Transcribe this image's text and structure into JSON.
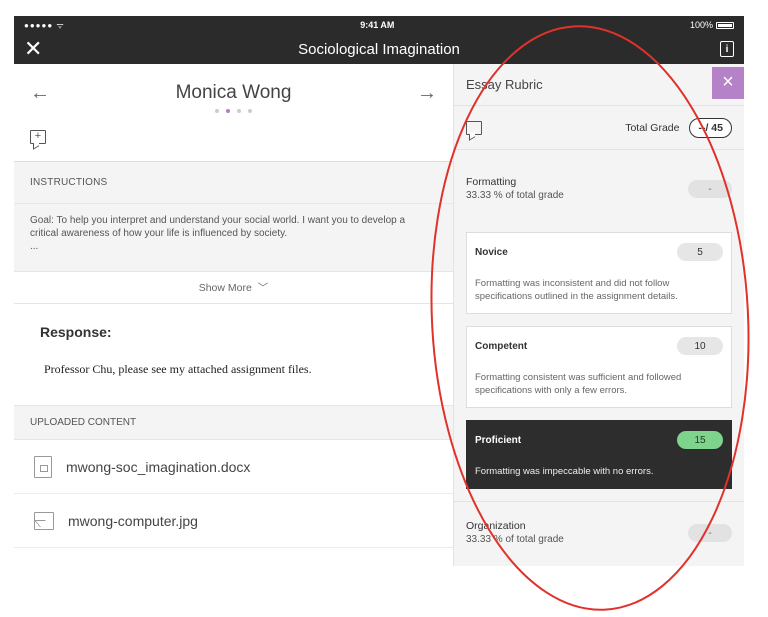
{
  "status_bar": {
    "signal": "●●●●● ᯤ",
    "time": "9:41 AM",
    "battery": "100%"
  },
  "nav": {
    "title": "Sociological Imagination",
    "close_icon": "close-icon",
    "info_icon": "info-icon",
    "info_glyph": "i"
  },
  "student": {
    "name": "Monica Wong",
    "prev_glyph": "←",
    "next_glyph": "→",
    "comment_glyph": "+"
  },
  "instructions": {
    "heading": "INSTRUCTIONS",
    "line1": "Goal: To help you interpret and understand your social world. I want you to develop a",
    "line2": "critical awareness of how your life is influenced by society.",
    "line3": "...",
    "show_more": "Show More",
    "chevron": "﹀"
  },
  "response": {
    "heading": "Response:",
    "text": "Professor Chu, please see my attached assignment files."
  },
  "uploaded": {
    "heading": "UPLOADED CONTENT",
    "files": [
      {
        "name": "mwong-soc_imagination.docx",
        "icon": "document-icon"
      },
      {
        "name": "mwong-computer.jpg",
        "icon": "image-icon"
      }
    ]
  },
  "rubric": {
    "title": "Essay Rubric",
    "close_glyph": "×",
    "total_grade_label": "Total Grade",
    "total_grade_value": "--/ 45",
    "criteria": [
      {
        "name": "Formatting",
        "percent": "33.33 % of total grade",
        "score": "-",
        "levels": [
          {
            "name": "Novice",
            "points": "5",
            "description": "Formatting was inconsistent and did not follow specifications outlined in the assignment details.",
            "selected": false
          },
          {
            "name": "Competent",
            "points": "10",
            "description": "Formatting consistent was sufficient and followed specifications with only a few errors.",
            "selected": false
          },
          {
            "name": "Proficient",
            "points": "15",
            "description": "Formatting was impeccable with no errors.",
            "selected": true
          }
        ]
      },
      {
        "name": "Organization",
        "percent": "33.33 % of total grade",
        "score": "-"
      }
    ]
  },
  "colors": {
    "nav_bg": "#2b2b2b",
    "accent_purple": "#b581c7",
    "selected_points_green": "#7ed38d",
    "annotation_red": "#e0322b"
  }
}
